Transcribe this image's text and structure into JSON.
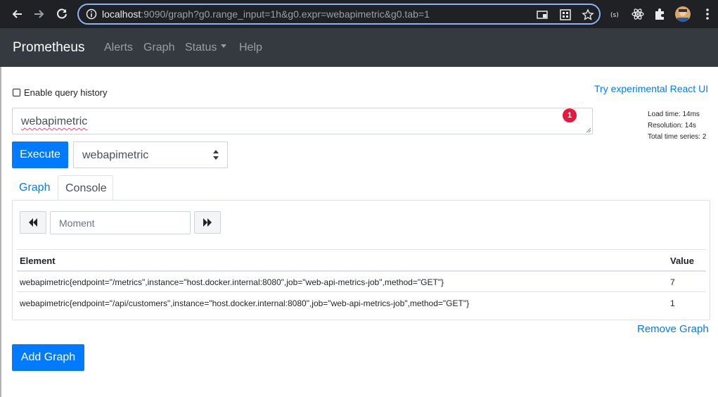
{
  "browser": {
    "url_host": "localhost",
    "url_rest": ":9090/graph?g0.range_input=1h&g0.expr=webapimetric&g0.tab=1"
  },
  "navbar": {
    "brand": "Prometheus",
    "links": [
      "Alerts",
      "Graph",
      "Status",
      "Help"
    ]
  },
  "options": {
    "query_history_label": "Enable query history",
    "react_ui_link": "Try experimental React UI"
  },
  "query": {
    "expression": "webapimetric",
    "error_count": "1"
  },
  "stats": {
    "load_time": "Load time: 14ms",
    "resolution": "Resolution: 14s",
    "total_series": "Total time series: 2"
  },
  "controls": {
    "execute_label": "Execute",
    "metric_select_value": "webapimetric"
  },
  "tabs": [
    "Graph",
    "Console"
  ],
  "console": {
    "moment_placeholder": "Moment",
    "columns": [
      "Element",
      "Value"
    ],
    "rows": [
      {
        "element": "webapimetric{endpoint=\"/metrics\",instance=\"host.docker.internal:8080\",job=\"web-api-metrics-job\",method=\"GET\"}",
        "value": "7"
      },
      {
        "element": "webapimetric{endpoint=\"/api/customers\",instance=\"host.docker.internal:8080\",job=\"web-api-metrics-job\",method=\"GET\"}",
        "value": "1"
      }
    ]
  },
  "actions": {
    "remove_graph": "Remove Graph",
    "add_graph": "Add Graph"
  },
  "colors": {
    "primary": "#007bff",
    "navbar_bg": "#343a40",
    "error_badge": "#e8173e"
  }
}
